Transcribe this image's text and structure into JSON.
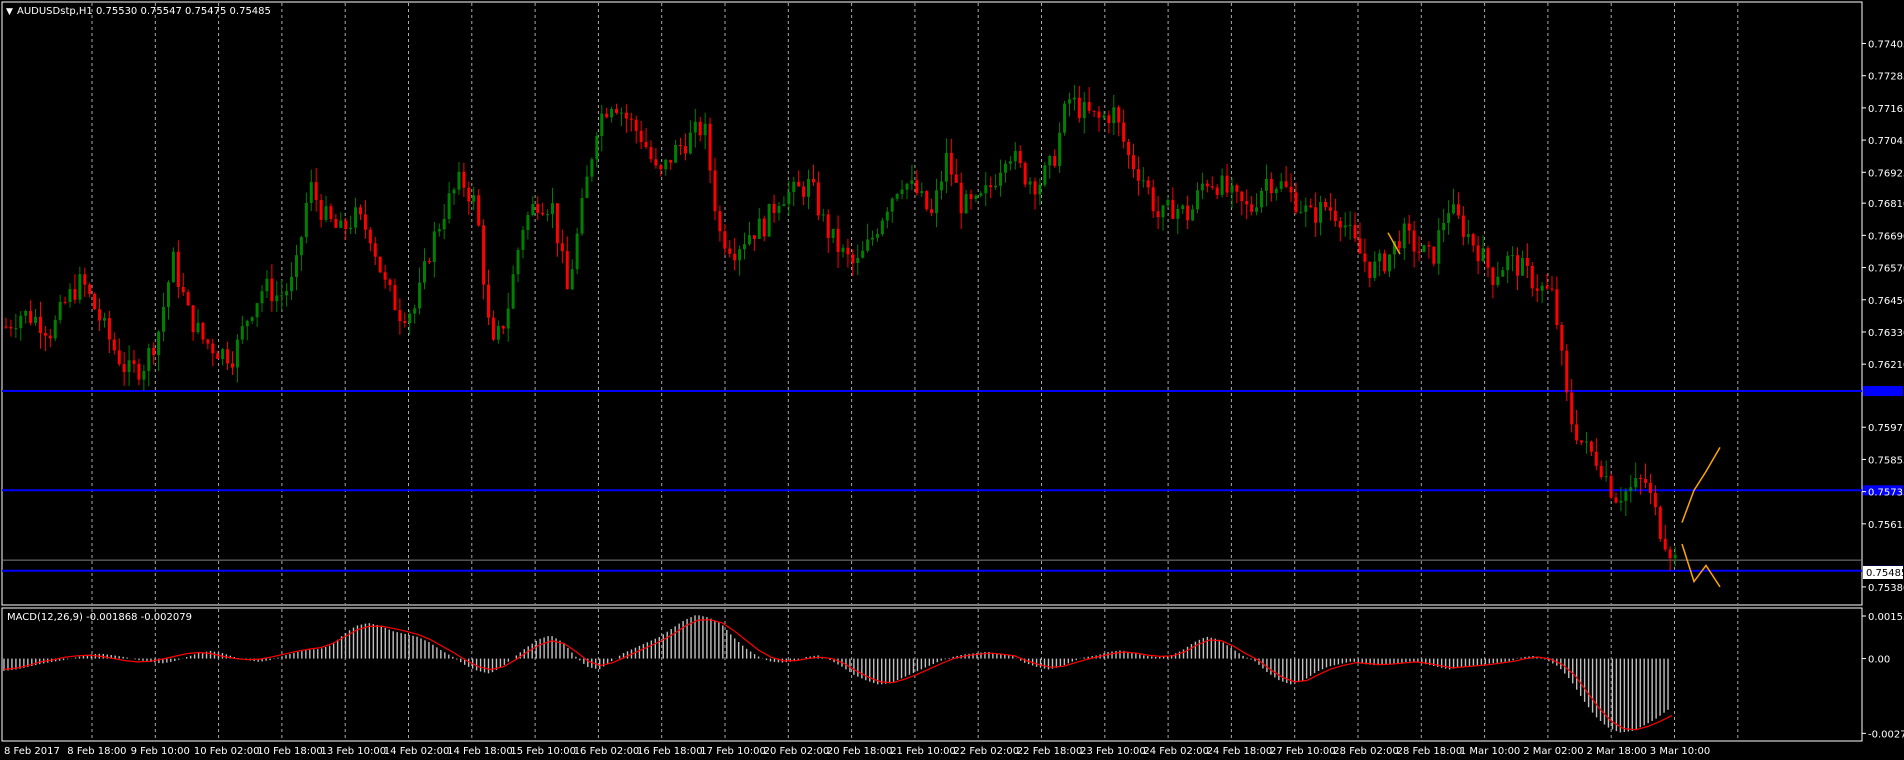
{
  "main": {
    "title": "AUDUSDstp,H1  0.75530 0.75547 0.75475 0.75485",
    "current_price_label": "0.75485"
  },
  "macd": {
    "title": "MACD(12,26,9) -0.001868 -0.002079"
  },
  "colors": {
    "background": "#000000",
    "bull": "#008000",
    "bear": "#ff0000",
    "grid": "#c8c8c8",
    "level": "#0000ff",
    "zigzag": "#ffa500",
    "signal": "#ff0000",
    "histogram": "#c0c0c0",
    "axis_text": "#ffffff"
  },
  "chart_data": [
    {
      "type": "candlestick",
      "symbol": "AUDUSDstp",
      "timeframe": "H1",
      "ohlc_last": {
        "open": 0.7553,
        "high": 0.75547,
        "low": 0.75475,
        "close": 0.75485
      },
      "ylim": [
        0.7532,
        0.775
      ],
      "y_ticks": [
        "0.77405",
        "0.77285",
        "0.77165",
        "0.77045",
        "0.76925",
        "0.76810",
        "0.76690",
        "0.76570",
        "0.76450",
        "0.76330",
        "0.76210",
        "0.75975",
        "0.75855",
        "0.75735",
        "0.75615",
        "0.75380"
      ],
      "x_labels": [
        "8 Feb 2017",
        "8 Feb 18:00",
        "9 Feb 10:00",
        "10 Feb 02:00",
        "10 Feb 18:00",
        "13 Feb 10:00",
        "14 Feb 02:00",
        "14 Feb 18:00",
        "15 Feb 10:00",
        "16 Feb 02:00",
        "16 Feb 18:00",
        "17 Feb 10:00",
        "20 Feb 02:00",
        "20 Feb 18:00",
        "21 Feb 10:00",
        "22 Feb 02:00",
        "22 Feb 18:00",
        "23 Feb 10:00",
        "24 Feb 02:00",
        "24 Feb 18:00",
        "27 Feb 10:00",
        "28 Feb 02:00",
        "28 Feb 18:00",
        "1 Mar 10:00",
        "2 Mar 02:00",
        "2 Mar 18:00",
        "3 Mar 10:00"
      ],
      "close_path": [
        0.7635,
        0.764,
        0.7638,
        0.7633,
        0.7645,
        0.7652,
        0.764,
        0.7628,
        0.7618,
        0.762,
        0.7632,
        0.766,
        0.764,
        0.763,
        0.7626,
        0.7624,
        0.764,
        0.765,
        0.7646,
        0.7652,
        0.7688,
        0.7676,
        0.767,
        0.7676,
        0.767,
        0.765,
        0.764,
        0.7642,
        0.7665,
        0.768,
        0.769,
        0.768,
        0.7625,
        0.764,
        0.7672,
        0.7682,
        0.768,
        0.7648,
        0.768,
        0.7712,
        0.772,
        0.7712,
        0.7705,
        0.769,
        0.77,
        0.7705,
        0.771,
        0.767,
        0.7664,
        0.767,
        0.7673,
        0.7684,
        0.7685,
        0.7688,
        0.7672,
        0.7663,
        0.7657,
        0.7667,
        0.768,
        0.769,
        0.7685,
        0.7676,
        0.7698,
        0.768,
        0.768,
        0.7688,
        0.7702,
        0.7692,
        0.7688,
        0.7696,
        0.772,
        0.7715,
        0.7712,
        0.7715,
        0.7698,
        0.769,
        0.7675,
        0.768,
        0.7676,
        0.769,
        0.7688,
        0.7682,
        0.7678,
        0.769,
        0.7688,
        0.7682,
        0.7676,
        0.768,
        0.7676,
        0.7664,
        0.7656,
        0.766,
        0.767,
        0.7664,
        0.766,
        0.768,
        0.7672,
        0.7664,
        0.7654,
        0.766,
        0.7656,
        0.765,
        0.7646,
        0.7602,
        0.759,
        0.7585,
        0.7572,
        0.7574,
        0.7578,
        0.756,
        0.75485
      ],
      "horizontal_levels": [
        0.7611,
        0.7574,
        0.7544,
        0.7548
      ],
      "zigzag_segments": [
        [
          [
            0.767
          ],
          [
            0.7662
          ]
        ],
        [
          [
            0.7562
          ],
          [
            0.7574
          ],
          [
            0.7581
          ],
          [
            0.759
          ]
        ],
        [
          [
            0.7554
          ],
          [
            0.754
          ],
          [
            0.7546
          ],
          [
            0.7538
          ]
        ]
      ]
    },
    {
      "type": "macd",
      "params": "12,26,9",
      "main_value": -0.001868,
      "signal_value": -0.002079,
      "ylim": [
        -0.0029,
        0.0017
      ],
      "y_ticks": [
        "0.001554",
        "0.00",
        "-0.002731"
      ],
      "histogram": [
        -0.00045,
        -0.0004,
        -0.0003,
        -0.0002,
        -0.00012,
        -5e-05,
        5e-05,
        0.00015,
        0.00018,
        0.00012,
        5e-05,
        -5e-05,
        -0.00012,
        -0.00018,
        -0.0001,
        5e-05,
        0.0002,
        0.00028,
        0.0002,
        5e-05,
        -5e-05,
        -0.00012,
        -5e-05,
        0.0001,
        0.00022,
        0.00032,
        0.00035,
        0.0005,
        0.0009,
        0.0012,
        0.0013,
        0.0012,
        0.001,
        0.0009,
        0.0008,
        0.0006,
        0.0003,
        5e-05,
        -0.00025,
        -0.00045,
        -0.00055,
        -0.0003,
        5e-05,
        0.0004,
        0.0007,
        0.00085,
        0.0006,
        0.0001,
        -0.0003,
        -0.0004,
        -0.0001,
        0.0002,
        0.0004,
        0.0006,
        0.0008,
        0.0011,
        0.0014,
        0.0016,
        0.0015,
        0.0013,
        0.0008,
        0.0004,
        0.0001,
        -0.0001,
        -0.00015,
        -0.0001,
        5e-05,
        0.00012,
        -5e-05,
        -0.0003,
        -0.0006,
        -0.0008,
        -0.00095,
        -0.0009,
        -0.0007,
        -0.0005,
        -0.0003,
        -0.0001,
        5e-05,
        0.00015,
        0.0002,
        0.00025,
        0.00015,
        0.0001,
        -0.00015,
        -0.0003,
        -0.0004,
        -0.0003,
        -0.0001,
        5e-05,
        0.00012,
        0.00025,
        0.0003,
        0.0002,
        0.0001,
        5e-05,
        0.0001,
        0.0003,
        0.0006,
        0.0008,
        0.0007,
        0.0004,
        0.0001,
        -0.0001,
        -0.0005,
        -0.0008,
        -0.00095,
        -0.0008,
        -0.0005,
        -0.0003,
        -0.0002,
        -0.0001,
        -0.0002,
        -0.00025,
        -0.0002,
        -0.00015,
        -0.0001,
        -0.0002,
        -0.0003,
        -0.0004,
        -0.0003,
        -0.00025,
        -0.0002,
        -0.00015,
        -0.0001,
        5e-05,
        0.0001,
        -5e-05,
        -0.0003,
        -0.0008,
        -0.0015,
        -0.0021,
        -0.0025,
        -0.0027,
        -0.00265,
        -0.00245,
        -0.0022,
        -0.00187
      ],
      "signal_path": [
        -0.0004,
        -0.00035,
        -0.00025,
        -0.00012,
        -5e-05,
        5e-05,
        0.0001,
        0.00012,
        8e-05,
        0.0,
        -8e-05,
        -0.00012,
        -0.0001,
        -2e-05,
        8e-05,
        0.00018,
        0.00022,
        0.00018,
        8e-05,
        0.0,
        -4e-05,
        -2e-05,
        6e-05,
        0.00016,
        0.00026,
        0.00034,
        0.0004,
        0.00055,
        0.0008,
        0.00105,
        0.00118,
        0.00118,
        0.0011,
        0.001,
        0.00088,
        0.0007,
        0.00045,
        0.0002,
        -8e-05,
        -0.0003,
        -0.0004,
        -0.0003,
        -5e-05,
        0.00025,
        0.0005,
        0.00065,
        0.00055,
        0.00025,
        -0.0001,
        -0.00025,
        -0.00015,
        5e-05,
        0.00025,
        0.00045,
        0.00065,
        0.0009,
        0.0012,
        0.0014,
        0.00142,
        0.0013,
        0.001,
        0.00065,
        0.0003,
        5e-05,
        -8e-05,
        -8e-05,
        0.0,
        5e-05,
        0.0,
        -0.00018,
        -0.00045,
        -0.00068,
        -0.00085,
        -0.00088,
        -0.00075,
        -0.00058,
        -0.00038,
        -0.00018,
        0.0,
        0.0001,
        0.00016,
        0.0002,
        0.00016,
        0.0001,
        -8e-05,
        -0.00022,
        -0.00032,
        -0.00028,
        -0.00015,
        -2e-05,
        8e-05,
        0.00018,
        0.00024,
        0.0002,
        0.00012,
        8e-05,
        0.0001,
        0.00025,
        0.0005,
        0.00068,
        0.00065,
        0.00045,
        0.00018,
        -5e-05,
        -0.0004,
        -0.00068,
        -0.00085,
        -0.0008,
        -0.00058,
        -0.00038,
        -0.00025,
        -0.00015,
        -0.00018,
        -0.00022,
        -0.0002,
        -0.00016,
        -0.00012,
        -0.00018,
        -0.00026,
        -0.00034,
        -0.0003,
        -0.00026,
        -0.00022,
        -0.00016,
        -0.0001,
        0.0,
        6e-05,
        -2e-05,
        -0.00022,
        -0.0006,
        -0.0012,
        -0.0018,
        -0.00228,
        -0.00255,
        -0.0026,
        -0.00248,
        -0.0023,
        -0.00208
      ]
    }
  ]
}
